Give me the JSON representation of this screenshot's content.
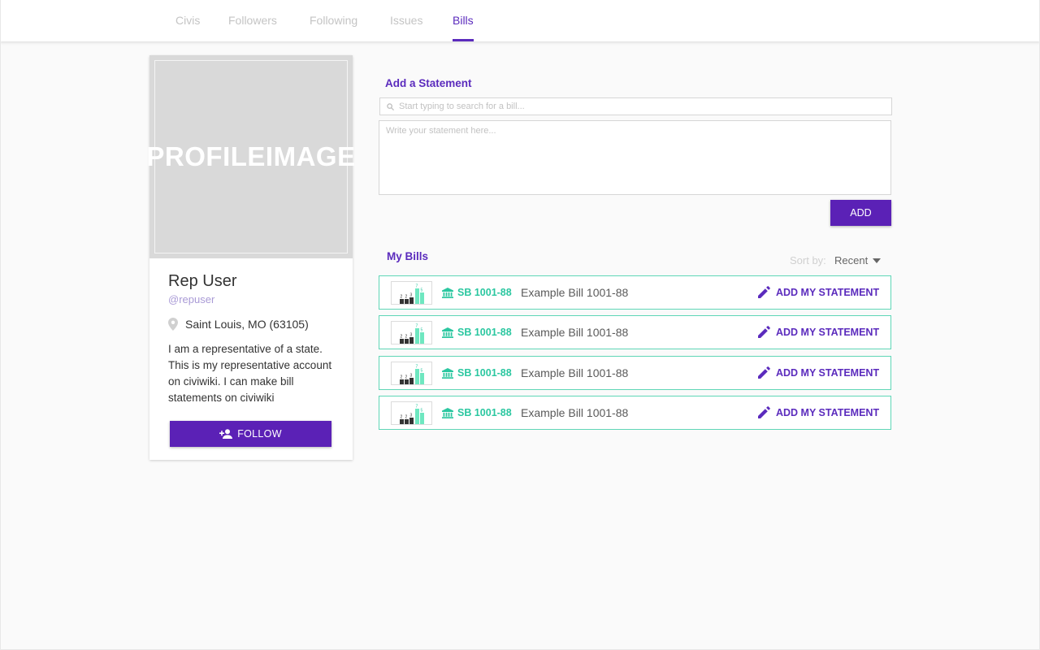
{
  "nav": {
    "tabs": [
      {
        "label": "Civis",
        "active": false
      },
      {
        "label": "Followers",
        "active": false
      },
      {
        "label": "Following",
        "active": false
      },
      {
        "label": "Issues",
        "active": false
      },
      {
        "label": "Bills",
        "active": true
      }
    ]
  },
  "profile": {
    "image_placeholder": "PROFILE IMAGE",
    "name": "Rep User",
    "handle": "@repuser",
    "location": "Saint Louis, MO (63105)",
    "bio": "I am a representative of a state. This is my representative account on civiwiki. I can make bill statements on civiwiki",
    "follow_label": "FOLLOW"
  },
  "statement": {
    "title": "Add a Statement",
    "search_placeholder": "Start typing to search for a bill...",
    "text_placeholder": "Write your statement here...",
    "add_label": "ADD"
  },
  "bills": {
    "title": "My Bills",
    "sort_label": "Sort by:",
    "sort_value": "Recent",
    "items": [
      {
        "code": "SB 1001-88",
        "title": "Example Bill 1001-88",
        "action": "ADD MY STATEMENT"
      },
      {
        "code": "SB 1001-88",
        "title": "Example Bill 1001-88",
        "action": "ADD MY STATEMENT"
      },
      {
        "code": "SB 1001-88",
        "title": "Example Bill 1001-88",
        "action": "ADD MY STATEMENT"
      },
      {
        "code": "SB 1001-88",
        "title": "Example Bill 1001-88",
        "action": "ADD MY STATEMENT"
      }
    ]
  },
  "thumb_labels": [
    "2",
    "2",
    "3",
    "7",
    "5"
  ],
  "colors": {
    "accent_purple": "#5b2bbd",
    "button_purple": "#5b21b6",
    "teal": "#2bc7a0",
    "row_border": "#5fd6b6"
  },
  "icons": {
    "location": "map-pin-icon",
    "follow": "person-add-icon",
    "search": "search-icon",
    "bill": "capitol-building-icon",
    "statement": "pencil-icon",
    "sort": "caret-down-icon"
  }
}
